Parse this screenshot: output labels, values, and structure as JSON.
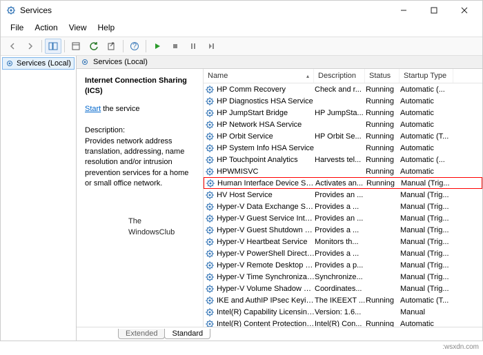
{
  "window": {
    "title": "Services"
  },
  "menu": {
    "file": "File",
    "action": "Action",
    "view": "View",
    "help": "Help"
  },
  "nav": {
    "label": "Services (Local)"
  },
  "header": {
    "label": "Services (Local)"
  },
  "detail": {
    "name": "Internet Connection Sharing (ICS)",
    "start_link": "Start",
    "start_rest": " the service",
    "desc_label": "Description:",
    "desc_text": "Provides network address translation, addressing, name resolution and/or intrusion prevention services for a home or small office network."
  },
  "columns": {
    "name": "Name",
    "desc": "Description",
    "status": "Status",
    "type": "Startup Type"
  },
  "rows": [
    {
      "name": "HP Comm Recovery",
      "desc": "Check and r...",
      "status": "Running",
      "type": "Automatic (..."
    },
    {
      "name": "HP Diagnostics HSA Service",
      "desc": "",
      "status": "Running",
      "type": "Automatic"
    },
    {
      "name": "HP JumpStart Bridge",
      "desc": "HP JumpSta...",
      "status": "Running",
      "type": "Automatic"
    },
    {
      "name": "HP Network HSA Service",
      "desc": "",
      "status": "Running",
      "type": "Automatic"
    },
    {
      "name": "HP Orbit Service",
      "desc": "HP Orbit Se...",
      "status": "Running",
      "type": "Automatic (T..."
    },
    {
      "name": "HP System Info HSA Service",
      "desc": "",
      "status": "Running",
      "type": "Automatic"
    },
    {
      "name": "HP Touchpoint Analytics",
      "desc": "Harvests tel...",
      "status": "Running",
      "type": "Automatic (..."
    },
    {
      "name": "HPWMISVC",
      "desc": "",
      "status": "Running",
      "type": "Automatic"
    },
    {
      "name": "Human Interface Device Service",
      "desc": "Activates an...",
      "status": "Running",
      "type": "Manual (Trig...",
      "hl": true
    },
    {
      "name": "HV Host Service",
      "desc": "Provides an ...",
      "status": "",
      "type": "Manual (Trig..."
    },
    {
      "name": "Hyper-V Data Exchange Service",
      "desc": "Provides a ...",
      "status": "",
      "type": "Manual (Trig..."
    },
    {
      "name": "Hyper-V Guest Service Interface",
      "desc": "Provides an ...",
      "status": "",
      "type": "Manual (Trig..."
    },
    {
      "name": "Hyper-V Guest Shutdown Service",
      "desc": "Provides a ...",
      "status": "",
      "type": "Manual (Trig..."
    },
    {
      "name": "Hyper-V Heartbeat Service",
      "desc": "Monitors th...",
      "status": "",
      "type": "Manual (Trig..."
    },
    {
      "name": "Hyper-V PowerShell Direct Service",
      "desc": "Provides a ...",
      "status": "",
      "type": "Manual (Trig..."
    },
    {
      "name": "Hyper-V Remote Desktop Virtualiz...",
      "desc": "Provides a p...",
      "status": "",
      "type": "Manual (Trig..."
    },
    {
      "name": "Hyper-V Time Synchronization Ser...",
      "desc": "Synchronize...",
      "status": "",
      "type": "Manual (Trig..."
    },
    {
      "name": "Hyper-V Volume Shadow Copy Re...",
      "desc": "Coordinates...",
      "status": "",
      "type": "Manual (Trig..."
    },
    {
      "name": "IKE and AuthIP IPsec Keying Modu...",
      "desc": "The IKEEXT ...",
      "status": "Running",
      "type": "Automatic (T..."
    },
    {
      "name": "Intel(R) Capability Licensing Servi...",
      "desc": "Version: 1.6...",
      "status": "",
      "type": "Manual"
    },
    {
      "name": "Intel(R) Content Protection HDCP ...",
      "desc": "Intel(R) Con...",
      "status": "Running",
      "type": "Automatic"
    }
  ],
  "tabs": {
    "extended": "Extended",
    "standard": "Standard"
  },
  "watermark": {
    "line1": "The",
    "line2": "WindowsClub"
  },
  "url": ":wsxdn.com"
}
